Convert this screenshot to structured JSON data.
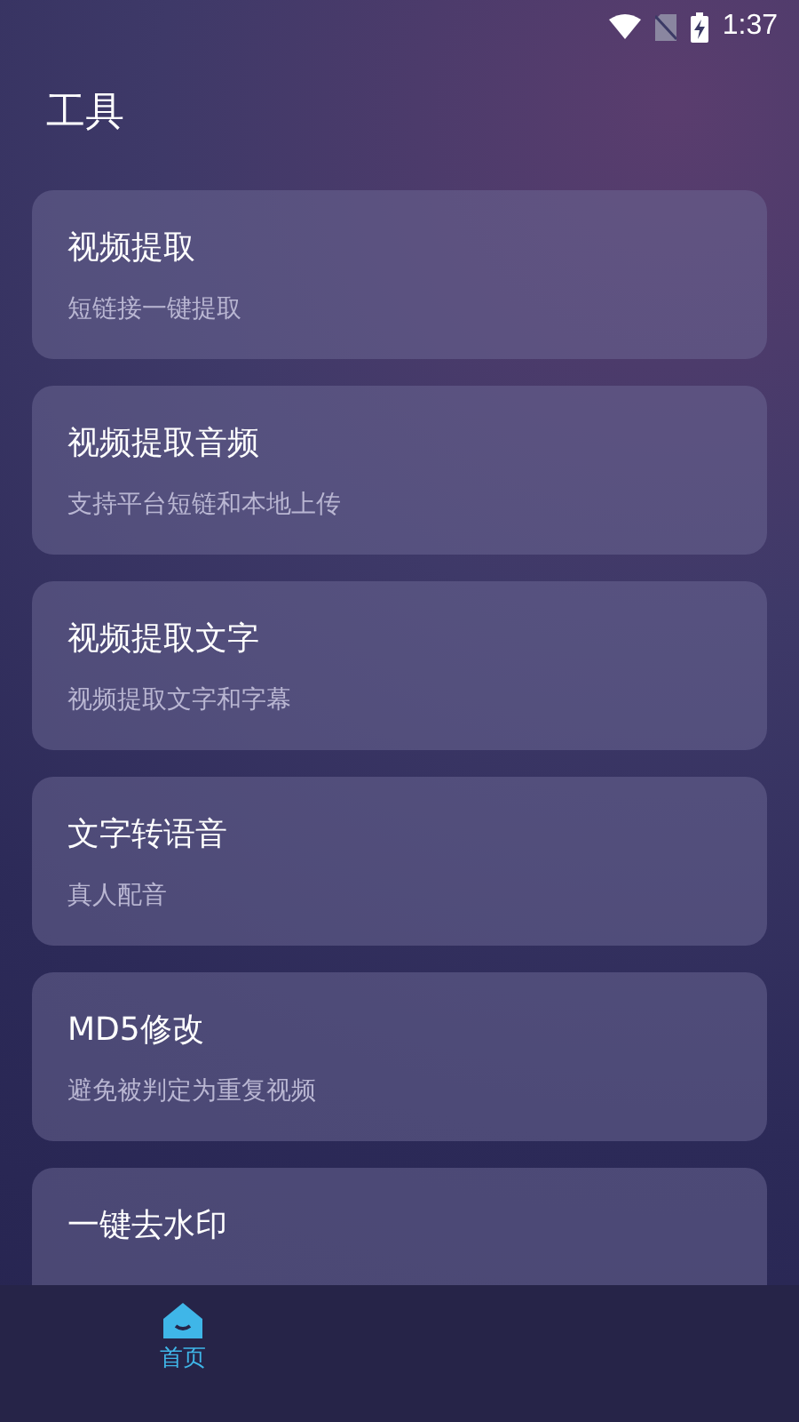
{
  "status_bar": {
    "time": "1:37"
  },
  "title": "工具",
  "tools": [
    {
      "title": "视频提取",
      "subtitle": "短链接一键提取"
    },
    {
      "title": "视频提取音频",
      "subtitle": "支持平台短链和本地上传"
    },
    {
      "title": "视频提取文字",
      "subtitle": "视频提取文字和字幕"
    },
    {
      "title": "文字转语音",
      "subtitle": "真人配音"
    },
    {
      "title": "MD5修改",
      "subtitle": "避免被判定为重复视频"
    },
    {
      "title": "一键去水印"
    }
  ],
  "nav": [
    {
      "label": "首页",
      "selected": true
    }
  ]
}
